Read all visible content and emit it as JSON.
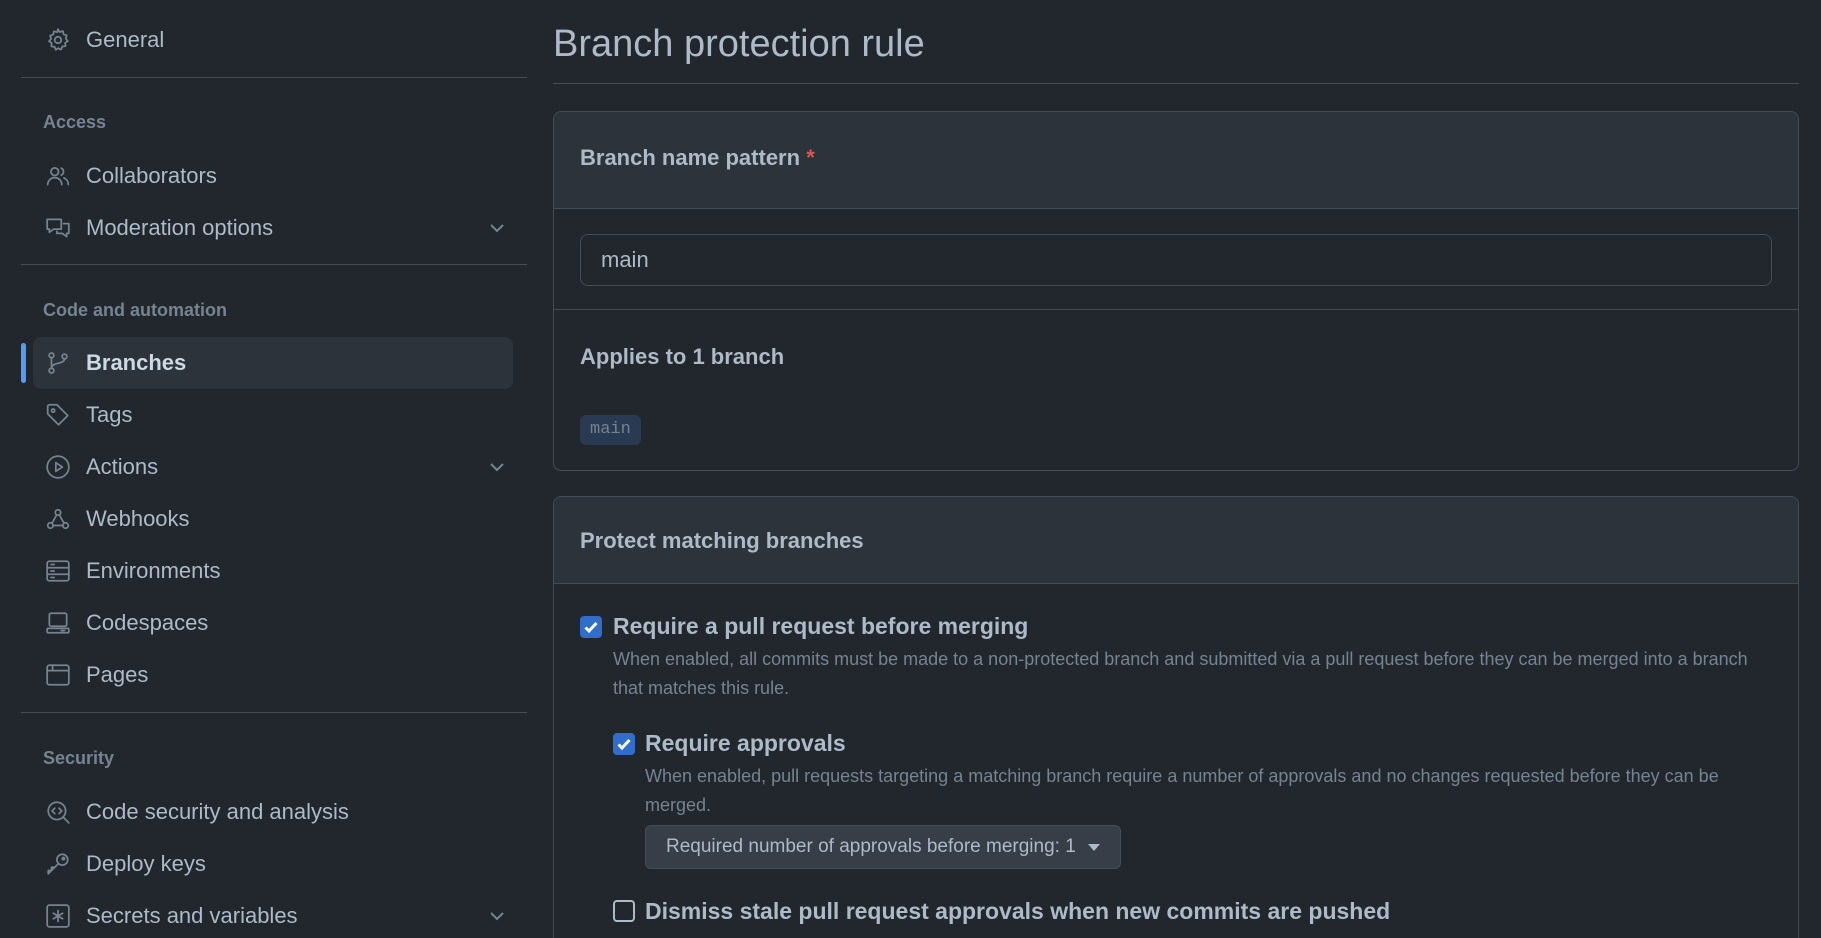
{
  "sidebar": {
    "general": "General",
    "sections": {
      "access": "Access",
      "code_automation": "Code and automation",
      "security": "Security"
    },
    "items": {
      "collaborators": "Collaborators",
      "moderation": "Moderation options",
      "branches": "Branches",
      "tags": "Tags",
      "actions": "Actions",
      "webhooks": "Webhooks",
      "environments": "Environments",
      "codespaces": "Codespaces",
      "pages": "Pages",
      "code_security": "Code security and analysis",
      "deploy_keys": "Deploy keys",
      "secrets": "Secrets and variables"
    },
    "active_item": "Branches"
  },
  "main": {
    "title": "Branch protection rule",
    "pattern_box": {
      "header": "Branch name pattern",
      "required_mark": "*",
      "input_value": "main",
      "applies_text": "Applies to 1 branch",
      "branch_tag": "main"
    },
    "protect_box": {
      "header": "Protect matching branches",
      "options": {
        "require_pr": {
          "label": "Require a pull request before merging",
          "description": "When enabled, all commits must be made to a non-protected branch and submitted via a pull request before they can be merged into a branch that matches this rule.",
          "checked": true
        },
        "require_approvals": {
          "label": "Require approvals",
          "description": "When enabled, pull requests targeting a matching branch require a number of approvals and no changes requested before they can be merged.",
          "checked": true,
          "select_label": "Required number of approvals before merging: 1"
        },
        "dismiss_stale": {
          "label": "Dismiss stale pull request approvals when new commits are pushed",
          "checked": false
        }
      }
    }
  },
  "colors": {
    "background": "#22272e",
    "panel": "#2d333b",
    "accent": "#539bf5",
    "checkbox": "#316dca",
    "required": "#e5534b"
  }
}
